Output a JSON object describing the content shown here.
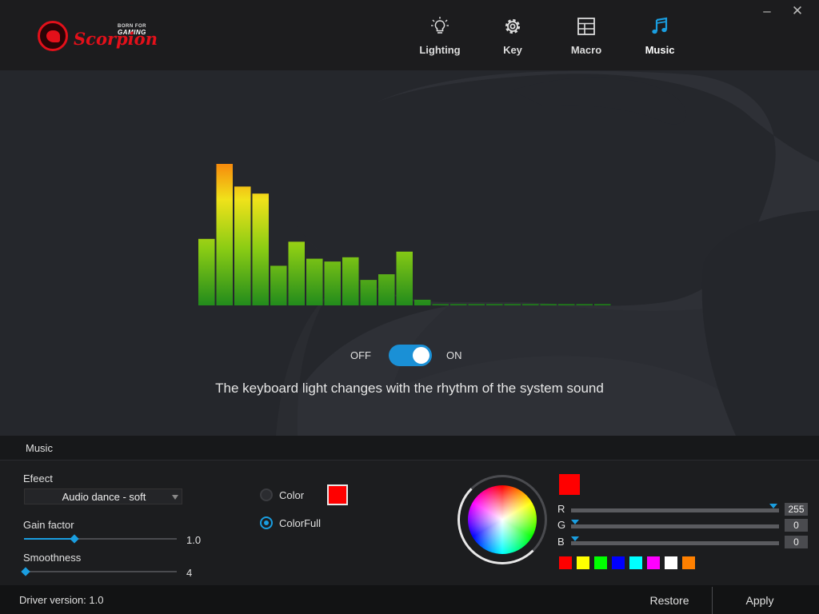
{
  "header": {
    "logo": {
      "tagline": "BORN FOR",
      "tagline_accent": "GAMING",
      "brand": "Scorpion"
    },
    "nav": [
      {
        "label": "Lighting",
        "icon": "bulb-icon"
      },
      {
        "label": "Key",
        "icon": "gear-icon"
      },
      {
        "label": "Macro",
        "icon": "grid-icon"
      },
      {
        "label": "Music",
        "icon": "music-note-icon",
        "active": true
      }
    ],
    "window": {
      "minimize": "–",
      "close": "✕"
    }
  },
  "main": {
    "equalizer_levels": [
      0.47,
      1.0,
      0.84,
      0.79,
      0.28,
      0.45,
      0.33,
      0.31,
      0.34,
      0.18,
      0.22,
      0.38,
      0.04,
      0.01,
      0.01,
      0.01,
      0.01,
      0.01,
      0.01,
      0.01,
      0.01,
      0.01,
      0.01
    ],
    "toggle": {
      "off_label": "OFF",
      "on_label": "ON",
      "state": "on"
    },
    "description": "The keyboard light changes with the rhythm of the system sound"
  },
  "section": {
    "title": "Music"
  },
  "settings": {
    "effect": {
      "label": "Efeect",
      "value": "Audio dance - soft"
    },
    "gain": {
      "label": "Gain factor",
      "value": "1.0",
      "level": 0.33
    },
    "smoothness": {
      "label": "Smoothness",
      "value": "4",
      "level": 0.0
    },
    "color_mode": {
      "color_label": "Color",
      "colorfull_label": "ColorFull",
      "selected": "ColorFull",
      "color_swatch": "#ff0000"
    },
    "rgb": {
      "preview": "#ff0000",
      "r_label": "R",
      "r_value": "255",
      "g_label": "G",
      "g_value": "0",
      "b_label": "B",
      "b_value": "0"
    },
    "presets": [
      "#ff0000",
      "#ffff00",
      "#00ff00",
      "#0000ff",
      "#00ffff",
      "#ff00ff",
      "#ffffff",
      "#ff8000"
    ]
  },
  "footer": {
    "driver": "Driver version: 1.0",
    "restore": "Restore",
    "apply": "Apply"
  }
}
